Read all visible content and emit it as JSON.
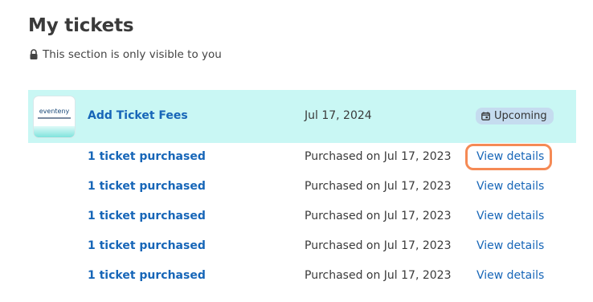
{
  "page": {
    "title": "My tickets",
    "visibility_note": "This section is only visible to you"
  },
  "event": {
    "thumbnail_logo": "eventeny",
    "name": "Add Ticket Fees",
    "date": "Jul 17, 2024",
    "status_badge": "Upcoming"
  },
  "tickets": [
    {
      "count": "1 ticket purchased",
      "purchased": "Purchased on Jul 17, 2023",
      "action": "View details"
    },
    {
      "count": "1 ticket purchased",
      "purchased": "Purchased on Jul 17, 2023",
      "action": "View details"
    },
    {
      "count": "1 ticket purchased",
      "purchased": "Purchased on Jul 17, 2023",
      "action": "View details"
    },
    {
      "count": "1 ticket purchased",
      "purchased": "Purchased on Jul 17, 2023",
      "action": "View details"
    },
    {
      "count": "1 ticket purchased",
      "purchased": "Purchased on Jul 17, 2023",
      "action": "View details"
    }
  ],
  "colors": {
    "event_row_bg": "#c9f7f4",
    "link": "#1766b8",
    "badge_bg": "#c5dcef",
    "highlight": "#f58a55"
  },
  "icons": {
    "visibility": "lock-icon",
    "badge": "calendar-icon"
  }
}
